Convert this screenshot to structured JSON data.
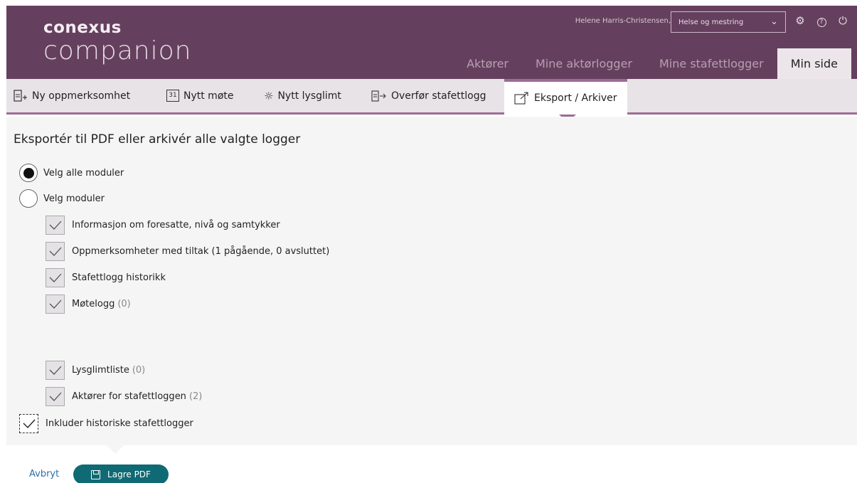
{
  "header": {
    "brand": "conexus",
    "product": "companion",
    "user_name": "Helene Harris-Christensen,",
    "role_select": {
      "value": "Helse og mestring"
    },
    "nav_tabs": [
      {
        "label": "Aktører"
      },
      {
        "label": "Mine aktørlogger"
      },
      {
        "label": "Mine stafettlogger"
      },
      {
        "label": "Min side"
      }
    ]
  },
  "toolbar": {
    "items": [
      {
        "label": "Ny oppmerksomhet",
        "icon": "new-document-icon"
      },
      {
        "label": "Nytt møte",
        "icon": "calendar-icon",
        "icon_text": "31"
      },
      {
        "label": "Nytt lysglimt",
        "icon": "sun-icon"
      },
      {
        "label": "Overfør stafettlogg",
        "icon": "transfer-icon"
      },
      {
        "label": "Eksport / Arkiver",
        "icon": "export-icon"
      }
    ],
    "active_index": 4
  },
  "panel": {
    "title": "Eksportér til PDF eller arkivér alle valgte logger",
    "radios": [
      {
        "label": "Velg alle moduler",
        "checked": true
      },
      {
        "label": "Velg moduler",
        "checked": false
      }
    ],
    "modules": [
      {
        "label": "Informasjon om foresatte, nivå og samtykker",
        "count": "",
        "checked": true
      },
      {
        "label": "Oppmerksomheter med tiltak (1 pågående, 0 avsluttet)",
        "count": "",
        "checked": true
      },
      {
        "label": "Stafettlogg historikk",
        "count": "",
        "checked": true
      },
      {
        "label": "Møtelogg",
        "count": "(0)",
        "checked": true
      },
      {
        "label": "Lysglimtliste",
        "count": "(0)",
        "checked": true
      },
      {
        "label": "Aktører for stafettloggen",
        "count": "(2)",
        "checked": true
      }
    ],
    "include_historic": {
      "label": "Inkluder historiske stafettlogger",
      "checked": true
    }
  },
  "footer": {
    "cancel_label": "Avbryt",
    "save_label": "Lagre PDF"
  },
  "colors": {
    "header_bg": "#65405e",
    "accent": "#9c6c95",
    "save_button": "#0f6a73",
    "link": "#2c6fa8"
  }
}
